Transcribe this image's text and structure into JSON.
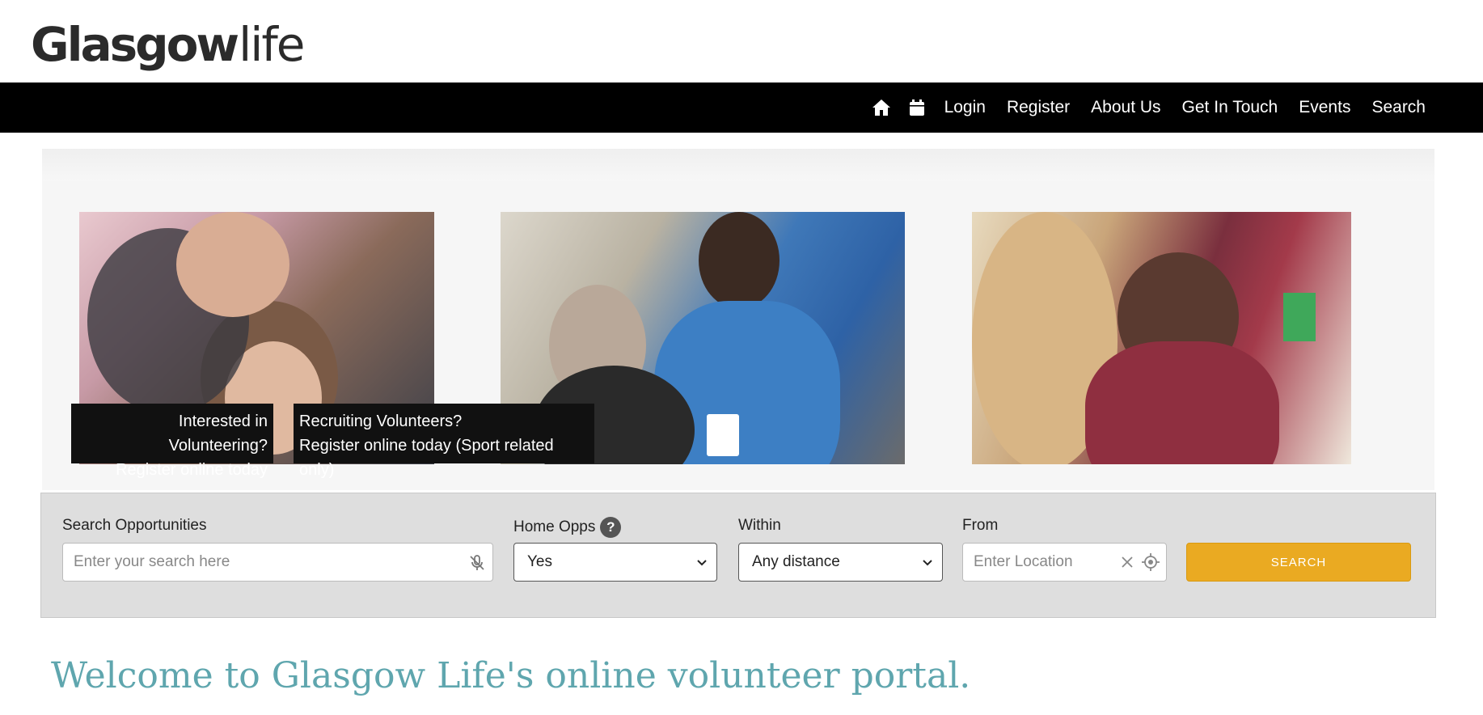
{
  "brand": {
    "logo_bold": "Glasgow",
    "logo_light": "life"
  },
  "nav": {
    "icons": [
      "home-icon",
      "calendar-icon"
    ],
    "items": [
      "Login",
      "Register",
      "About Us",
      "Get In Touch",
      "Events",
      "Search"
    ]
  },
  "hero": {
    "caption1": {
      "line1": "Interested in Volunteering?",
      "line2": "Register online today"
    },
    "caption2": {
      "line1": "Recruiting Volunteers?",
      "line2": "Register online today (Sport related only)"
    }
  },
  "search": {
    "opportunities_label": "Search Opportunities",
    "opportunities_placeholder": "Enter your search here",
    "home_opps_label": "Home Opps",
    "home_opps_help": "?",
    "home_opps_value": "Yes",
    "within_label": "Within",
    "within_value": "Any distance",
    "from_label": "From",
    "from_placeholder": "Enter Location",
    "button_label": "SEARCH"
  },
  "welcome": "Welcome to Glasgow Life's online volunteer portal.",
  "colors": {
    "nav_bg": "#000000",
    "accent": "#eaaa22",
    "welcome": "#5fa6ae",
    "panel": "#dedede"
  }
}
